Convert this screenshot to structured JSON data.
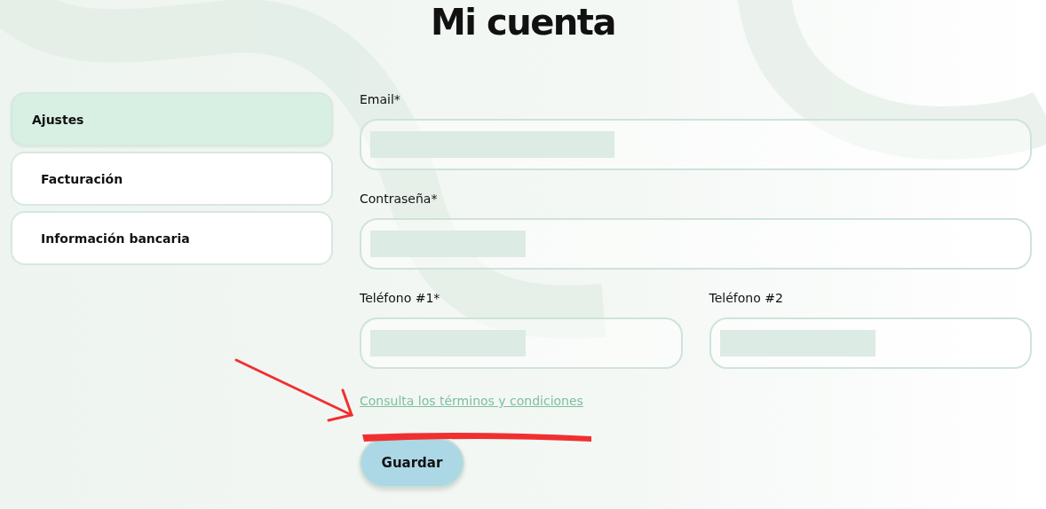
{
  "title": "Mi cuenta",
  "sidebar": {
    "items": [
      {
        "label": "Ajustes",
        "selected": true
      },
      {
        "label": "Facturación",
        "selected": false
      },
      {
        "label": "Información bancaria",
        "selected": false
      }
    ]
  },
  "form": {
    "fields": [
      {
        "label": "Email*",
        "redacted": true
      },
      {
        "label": "Contraseña*",
        "redacted": true
      }
    ],
    "phone_fields": [
      {
        "label": "Teléfono #1*",
        "redacted": true
      },
      {
        "label": "Teléfono #2",
        "redacted": true
      }
    ],
    "terms_link": "Consulta los términos y condiciones",
    "save_button": "Guardar"
  },
  "annotations": {
    "arrow": true,
    "underline": true
  }
}
